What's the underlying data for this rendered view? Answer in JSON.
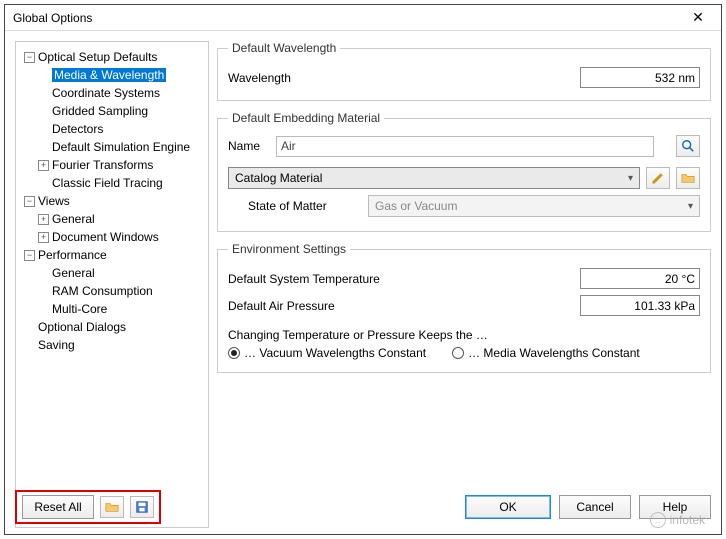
{
  "window": {
    "title": "Global Options",
    "close": "✕"
  },
  "tree": {
    "n0": "Optical Setup Defaults",
    "n0_0": "Media & Wavelength",
    "n0_1": "Coordinate Systems",
    "n0_2": "Gridded Sampling",
    "n0_3": "Detectors",
    "n0_4": "Default Simulation Engine",
    "n0_5": "Fourier Transforms",
    "n0_6": "Classic Field Tracing",
    "n1": "Views",
    "n1_0": "General",
    "n1_1": "Document Windows",
    "n2": "Performance",
    "n2_0": "General",
    "n2_1": "RAM Consumption",
    "n2_2": "Multi-Core",
    "n3": "Optional Dialogs",
    "n4": "Saving"
  },
  "panel": {
    "defaultWavelength": {
      "legend": "Default Wavelength",
      "label": "Wavelength",
      "value": "532 nm"
    },
    "defaultEmbedding": {
      "legend": "Default Embedding Material",
      "nameLabel": "Name",
      "nameValue": "Air",
      "catalog": "Catalog Material",
      "stateLabel": "State of Matter",
      "stateValue": "Gas or Vacuum"
    },
    "env": {
      "legend": "Environment Settings",
      "tempLabel": "Default System Temperature",
      "tempValue": "20 °C",
      "pressLabel": "Default Air Pressure",
      "pressValue": "101.33 kPa",
      "changing": "Changing Temperature or Pressure Keeps the …",
      "opt1": "… Vacuum Wavelengths Constant",
      "opt2": "… Media Wavelengths Constant"
    }
  },
  "footer": {
    "resetAll": "Reset All",
    "ok": "OK",
    "cancel": "Cancel",
    "help": "Help"
  },
  "watermark": "infotek"
}
